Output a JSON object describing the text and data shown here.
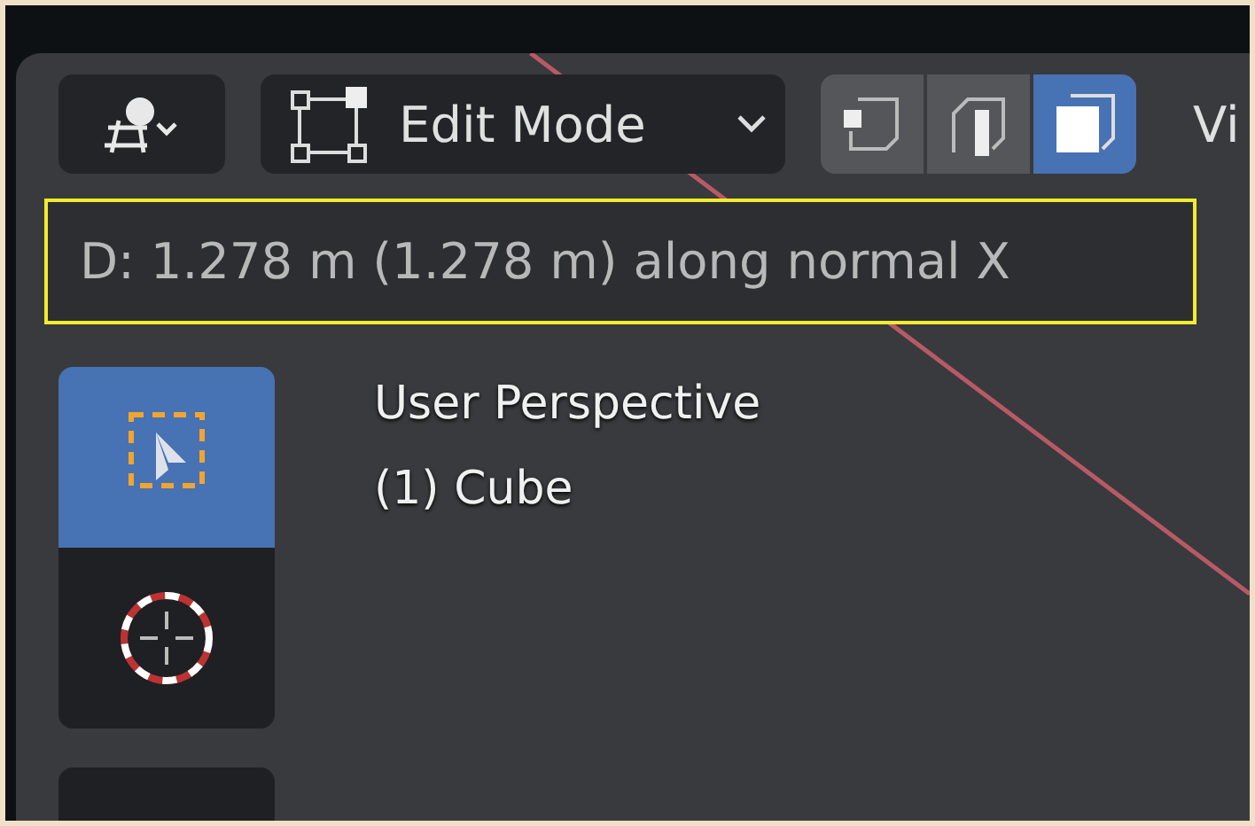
{
  "header": {
    "mode_dropdown": {
      "label": "Edit Mode"
    },
    "select_modes": [
      {
        "kind": "vertex",
        "selected": false
      },
      {
        "kind": "edge",
        "selected": false
      },
      {
        "kind": "face",
        "selected": true
      }
    ],
    "menu_cut": "Vi"
  },
  "status": "D: 1.278 m (1.278 m) along normal X",
  "tools": [
    {
      "kind": "select",
      "selected": true
    },
    {
      "kind": "cursor",
      "selected": false
    }
  ],
  "overlay": [
    "User Perspective",
    "(1) Cube"
  ]
}
